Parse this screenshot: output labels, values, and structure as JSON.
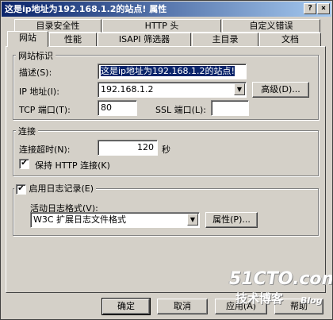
{
  "window": {
    "title": "这是ip地址为192.168.1.2的站点! 属性",
    "help_label": "?",
    "close_label": "×"
  },
  "tabs_row1": [
    "目录安全性",
    "HTTP 头",
    "自定义错误"
  ],
  "tabs_row2": [
    "网站",
    "性能",
    "ISAPI 筛选器",
    "主目录",
    "文档"
  ],
  "website_id": {
    "group_label": "网站标识",
    "description_label": "描述(S):",
    "description_value": "这是ip地址为192.168.1.2的站点!",
    "ip_label": "IP 地址(I):",
    "ip_value": "192.168.1.2",
    "advanced_label": "高级(D)...",
    "tcp_label": "TCP 端口(T):",
    "tcp_value": "80",
    "ssl_label": "SSL 端口(L):",
    "ssl_value": ""
  },
  "connection": {
    "group_label": "连接",
    "timeout_label": "连接超时(N):",
    "timeout_value": "120",
    "timeout_unit": "秒",
    "keepalive_label": "保持 HTTP 连接(K)",
    "keepalive_checked": true
  },
  "logging": {
    "enable_label": "启用日志记录(E)",
    "enable_checked": true,
    "format_label": "活动日志格式(V):",
    "format_value": "W3C 扩展日志文件格式",
    "properties_label": "属性(P)..."
  },
  "buttons": {
    "ok": "确定",
    "cancel": "取消",
    "apply": "应用(A)",
    "help": "帮助"
  },
  "watermark": {
    "site": "51CTO.com",
    "tagline": "技术博客",
    "blog": "Blog"
  },
  "icons": {
    "check": "✔",
    "dropdown": "▼"
  }
}
